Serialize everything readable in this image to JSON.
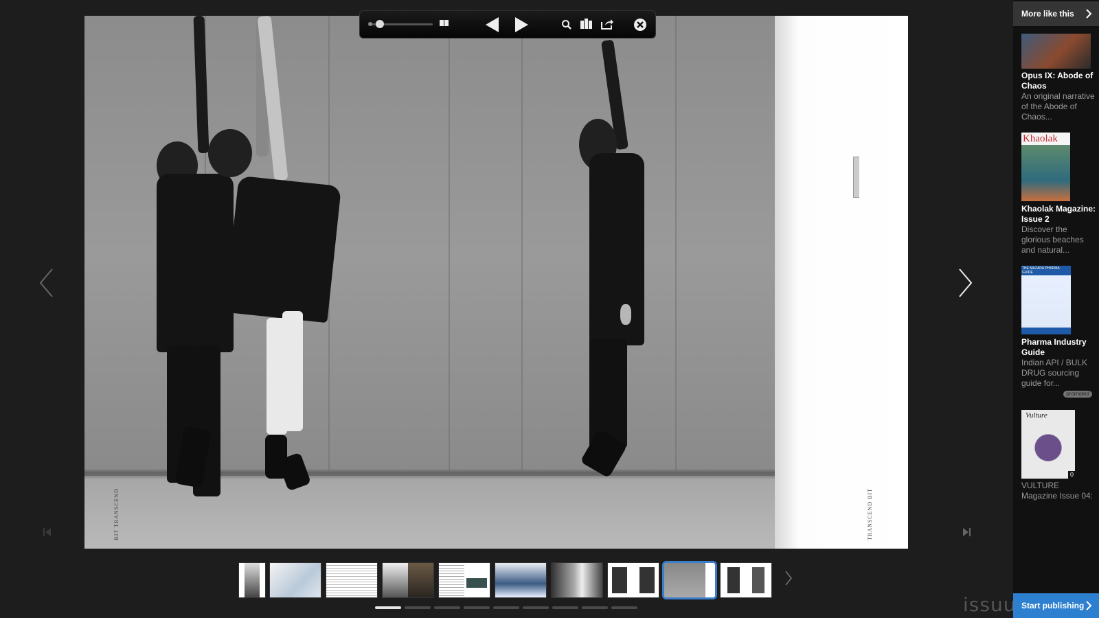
{
  "spread": {
    "left_page_caption": "BIT TRANSCEND",
    "right_page_caption": "TRANSCEND BIT"
  },
  "toolbar": {
    "zoom_level": 0.1,
    "icons": [
      "zoom-slider",
      "double-page-icon",
      "prev-icon",
      "play-icon",
      "search-icon",
      "library-icon",
      "share-icon",
      "close-icon"
    ]
  },
  "thumbnails": {
    "count": 10,
    "active_index": 8
  },
  "pager": {
    "count": 9,
    "active_index": 0
  },
  "sidebar": {
    "header": "More like this",
    "items": [
      {
        "title": "Opus IX: Abode of Chaos",
        "desc": "An original narrative of the Abode of Chaos..."
      },
      {
        "title": "Khaolak Magazine: Issue 2",
        "desc": "Discover the glorious beaches and natural...",
        "cover_text": "Khaolak"
      },
      {
        "title": "Pharma Industry Guide",
        "desc": "Indian API / BULK DRUG sourcing guide for...",
        "badge": "promoted",
        "cover_text": "THE MAZADA PHARMA GUIDE"
      },
      {
        "title": "VULTURE Magazine Issue 04:",
        "desc": "",
        "cover_text": "Vulture",
        "count": "0"
      }
    ],
    "start_button": "Start publishing"
  },
  "brand": {
    "logo": "issuu",
    "accent": "#2d7fd0"
  }
}
